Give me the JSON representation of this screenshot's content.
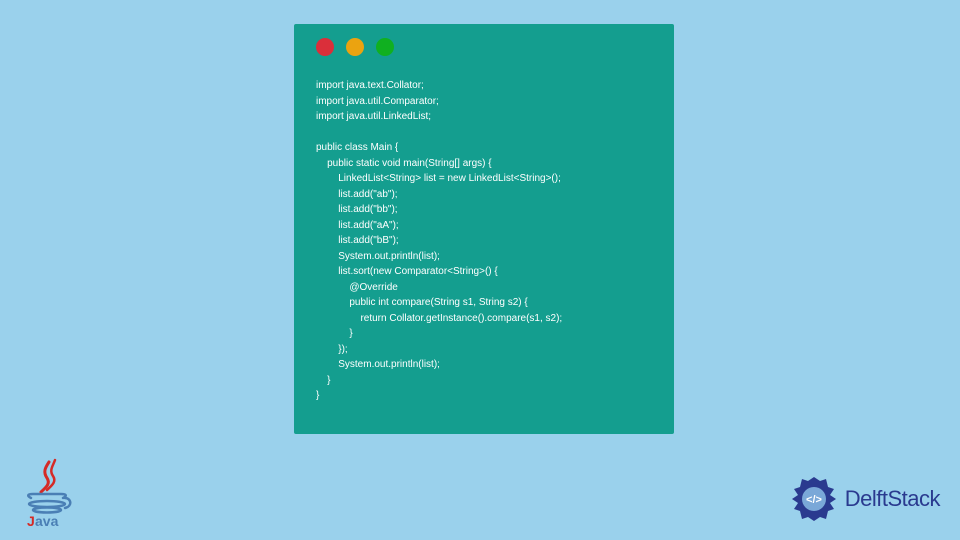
{
  "code": {
    "lines": [
      "import java.text.Collator;",
      "import java.util.Comparator;",
      "import java.util.LinkedList;",
      "",
      "public class Main {",
      "    public static void main(String[] args) {",
      "        LinkedList<String> list = new LinkedList<String>();",
      "        list.add(\"ab\");",
      "        list.add(\"bb\");",
      "        list.add(\"aA\");",
      "        list.add(\"bB\");",
      "        System.out.println(list);",
      "        list.sort(new Comparator<String>() {",
      "            @Override",
      "            public int compare(String s1, String s2) {",
      "                return Collator.getInstance().compare(s1, s2);",
      "            }",
      "        });",
      "        System.out.println(list);",
      "    }",
      "}"
    ]
  },
  "branding": {
    "java_label": "Java",
    "delft_label": "DelftStack"
  },
  "window": {
    "dot_colors": {
      "red": "#da2f3a",
      "yellow": "#eba310",
      "green": "#10b020"
    }
  }
}
